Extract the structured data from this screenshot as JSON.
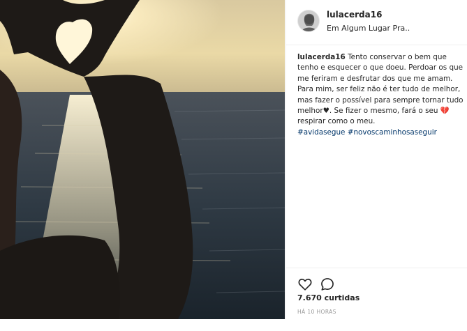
{
  "header": {
    "username": "lulacerda16",
    "location": "Em Algum Lugar Pra.."
  },
  "caption": {
    "username": "lulacerda16",
    "text": "Tento conservar o bem que tenho e esquecer o que doeu. Perdoar os que me feriram e desfrutar dos que me amam. Para mim, ser feliz não é ter tudo de melhor, mas fazer o possível para sempre tornar tudo melhor♥. Se fizer o mesmo, fará o seu 💔 respirar como o meu.",
    "hashtags": [
      "#avidasegue",
      "#novoscaminhosaseguir"
    ]
  },
  "actions": {
    "like_icon": "heart-outline-icon",
    "comment_icon": "comment-bubble-icon",
    "likes": "7.670 curtidas",
    "time": "HÁ 10 HORAS"
  },
  "colors": {
    "text": "#262626",
    "hashtag": "#003569",
    "muted": "#999999",
    "divider": "#efefef"
  }
}
